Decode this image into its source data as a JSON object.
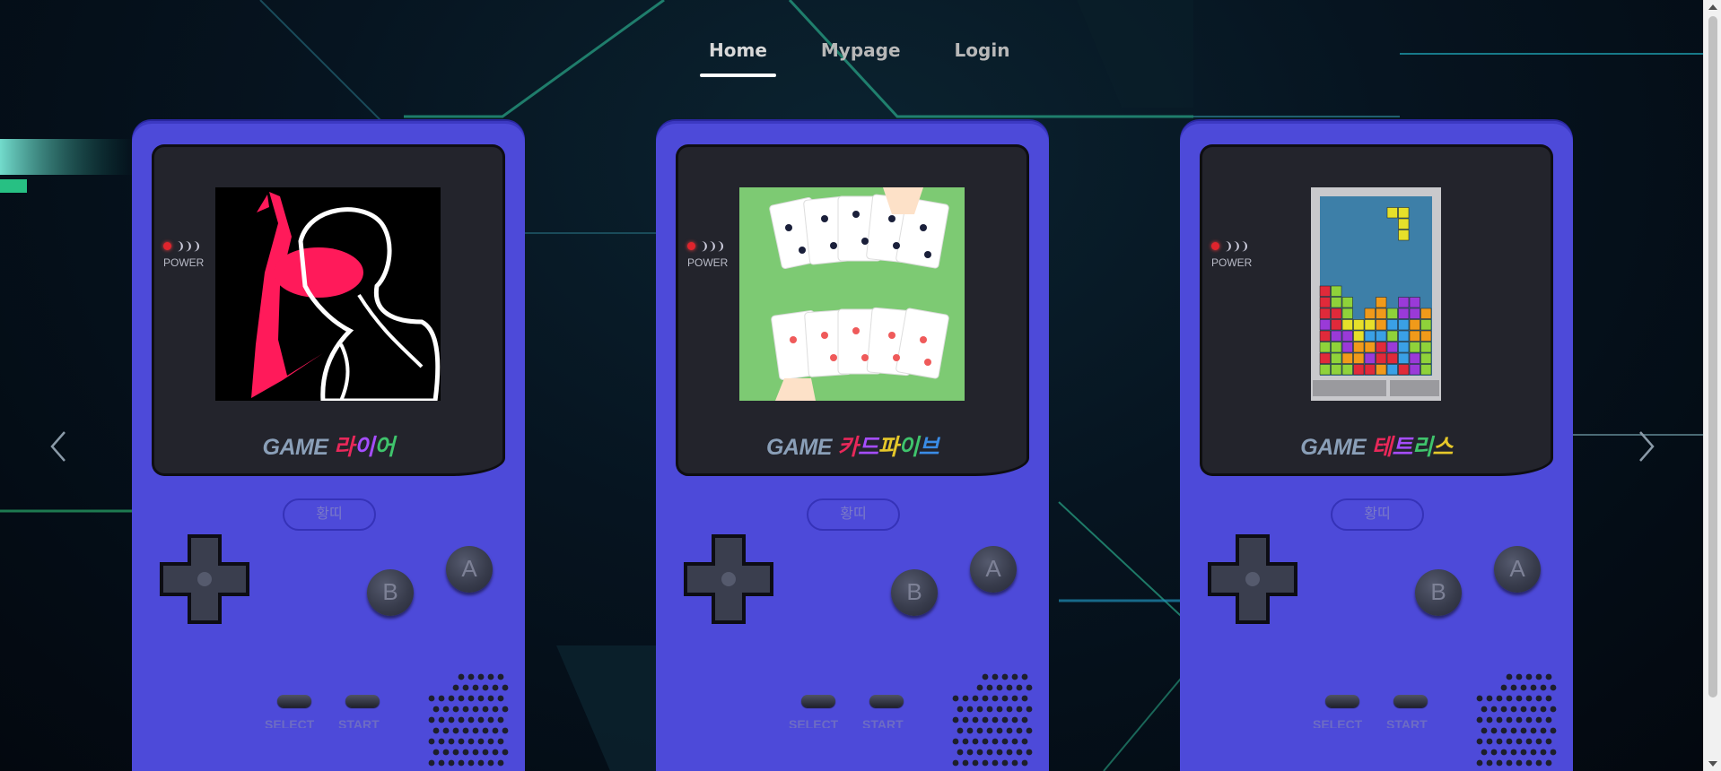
{
  "nav": {
    "items": [
      {
        "label": "Home",
        "active": true
      },
      {
        "label": "Mypage",
        "active": false
      },
      {
        "label": "Login",
        "active": false
      }
    ]
  },
  "carousel": {
    "prev_icon": "chevron-left-icon",
    "next_icon": "chevron-right-icon"
  },
  "console": {
    "power_label": "POWER",
    "brand_label": "황띠",
    "button_b": "B",
    "button_a": "A",
    "select_label": "SELECT",
    "start_label": "START",
    "body_color": "#4d4ad9"
  },
  "games": [
    {
      "prefix": "GAME",
      "name_chars": [
        "라",
        "이",
        "어"
      ],
      "art": "liar-art"
    },
    {
      "prefix": "GAME",
      "name_chars": [
        "카",
        "드",
        "파",
        "이",
        "브"
      ],
      "art": "card-five-art"
    },
    {
      "prefix": "GAME",
      "name_chars": [
        "테",
        "트",
        "리",
        "스"
      ],
      "art": "tetris-art"
    }
  ]
}
